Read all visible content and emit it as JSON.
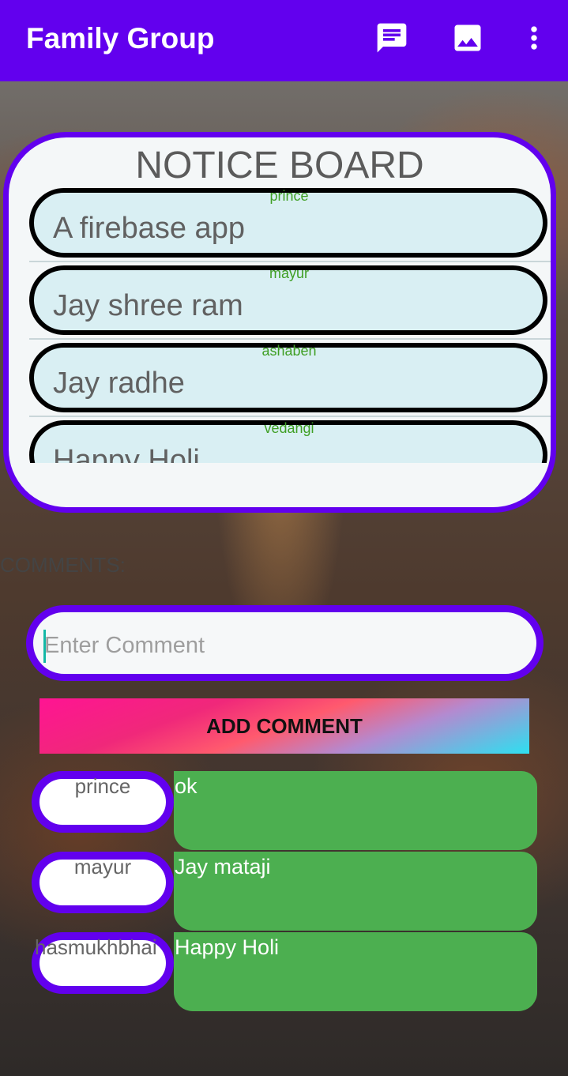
{
  "app_bar": {
    "title": "Family Group",
    "icons": [
      "message-icon",
      "image-icon",
      "more-vert-icon"
    ],
    "color": "#6200ee"
  },
  "notice_board": {
    "title": "NOTICE BOARD",
    "items": [
      {
        "author": "prince",
        "text": "A firebase app"
      },
      {
        "author": "mayur",
        "text": "Jay shree ram"
      },
      {
        "author": "ashaben",
        "text": "Jay radhe"
      },
      {
        "author": "vedangi",
        "text": "Happy Holi"
      }
    ]
  },
  "comments": {
    "label": "COMMENTS:",
    "input_placeholder": "Enter Comment",
    "add_button_label": "ADD COMMENT",
    "items": [
      {
        "user": "prince",
        "message": "ok"
      },
      {
        "user": "mayur",
        "message": "Jay mataji"
      },
      {
        "user": "hasmukhbhai",
        "message": "Happy  Holi"
      }
    ]
  }
}
